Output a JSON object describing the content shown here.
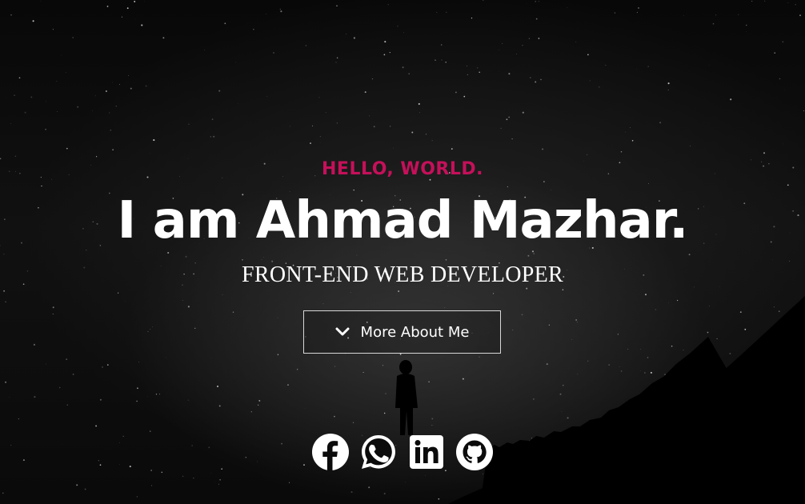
{
  "hero": {
    "greeting": "HELLO, WORLD.",
    "name": "I am Ahmad Mazhar.",
    "role": "FRONT-END WEB DEVELOPER",
    "cta_label": "More About Me",
    "cta_icon": "chevron-down-icon"
  },
  "social": [
    {
      "name": "facebook-icon"
    },
    {
      "name": "whatsapp-icon"
    },
    {
      "name": "linkedin-icon"
    },
    {
      "name": "github-icon"
    }
  ],
  "colors": {
    "accent": "#c5105a",
    "text": "#ffffff",
    "background": "#050505"
  }
}
